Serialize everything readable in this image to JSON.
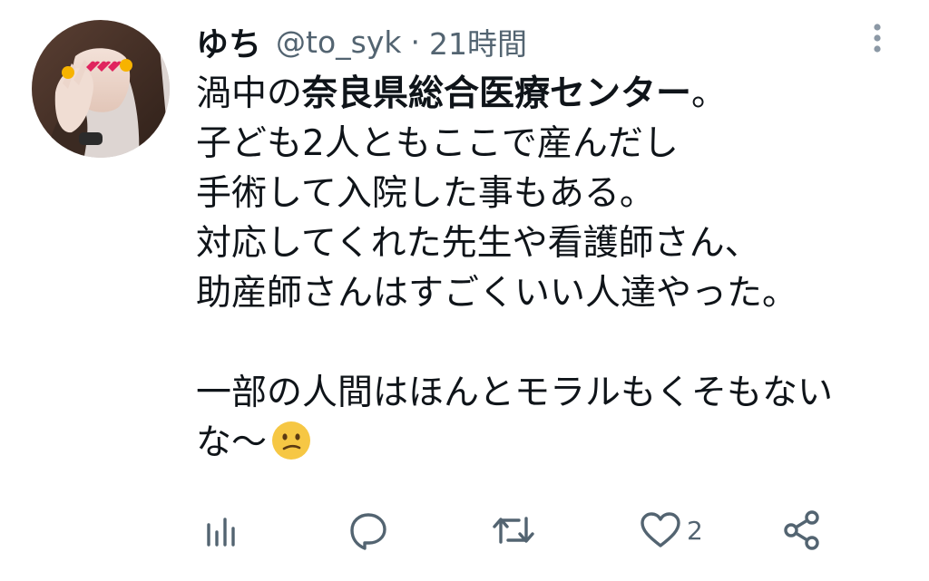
{
  "tweet": {
    "author_name": "ゆち",
    "handle": "@to_syk",
    "separator": "·",
    "time": "21時間",
    "lines": [
      {
        "pre": "渦中の",
        "bold": "奈良県総合医療センター",
        "post": "。"
      },
      {
        "text": "子ども2人ともここで産んだし"
      },
      {
        "text": "手術して入院した事もある。"
      },
      {
        "text": "対応してくれた先生や看護師さん、"
      },
      {
        "text": "助産師さんはすごくいい人達やった。"
      },
      {
        "text": ""
      },
      {
        "text": "一部の人間はほんとモラルもくそもない"
      },
      {
        "text": "な〜",
        "emoji": "confused-face"
      }
    ],
    "actions": {
      "analytics": {
        "icon": "analytics-icon"
      },
      "reply": {
        "icon": "reply-icon"
      },
      "retweet": {
        "icon": "retweet-icon"
      },
      "like": {
        "icon": "heart-icon",
        "count": "2"
      },
      "share": {
        "icon": "share-icon"
      }
    }
  },
  "colors": {
    "text": "#0f1419",
    "secondary": "#536471",
    "background": "#ffffff"
  }
}
